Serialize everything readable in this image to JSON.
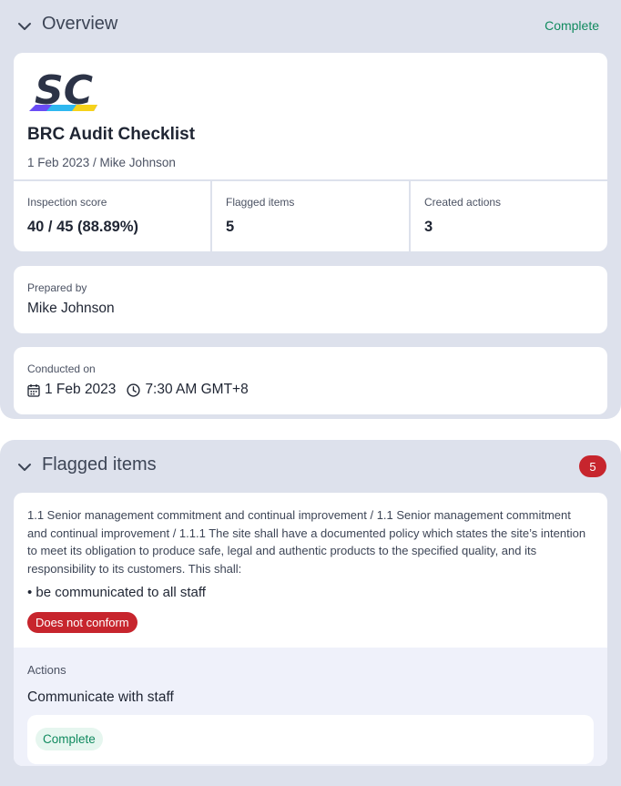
{
  "overview": {
    "title": "Overview",
    "status": "Complete",
    "logo_text": "SC",
    "doc_title": "BRC Audit Checklist",
    "doc_subtitle": "1 Feb 2023 / Mike Johnson",
    "stats": [
      {
        "label": "Inspection score",
        "value": "40 / 45 (88.89%)"
      },
      {
        "label": "Flagged items",
        "value": "5"
      },
      {
        "label": "Created actions",
        "value": "3"
      }
    ],
    "prepared_by": {
      "label": "Prepared by",
      "value": "Mike Johnson"
    },
    "conducted_on": {
      "label": "Conducted on",
      "date": "1 Feb 2023",
      "time": "7:30 AM GMT+8"
    }
  },
  "flagged": {
    "title": "Flagged items",
    "count": "5",
    "item": {
      "question": "1.1 Senior management commitment and continual improvement / 1.1 Senior management commitment and continual improvement / 1.1.1 The site shall have a documented policy which states the site’s intention to meet its obligation to produce safe, legal and authentic products to the specified quality, and its responsibility to its customers. This shall:",
      "bullet": "• be communicated to all staff",
      "response": "Does not conform",
      "actions_label": "Actions",
      "action_title": "Communicate with staff",
      "action_status": "Complete"
    }
  },
  "colors": {
    "section_bg": "#dde1ec",
    "success": "#118a5f",
    "danger": "#c7252d",
    "logo_dark": "#2c3347"
  },
  "icons": [
    "chevron-down-icon",
    "calendar-icon",
    "clock-icon"
  ]
}
